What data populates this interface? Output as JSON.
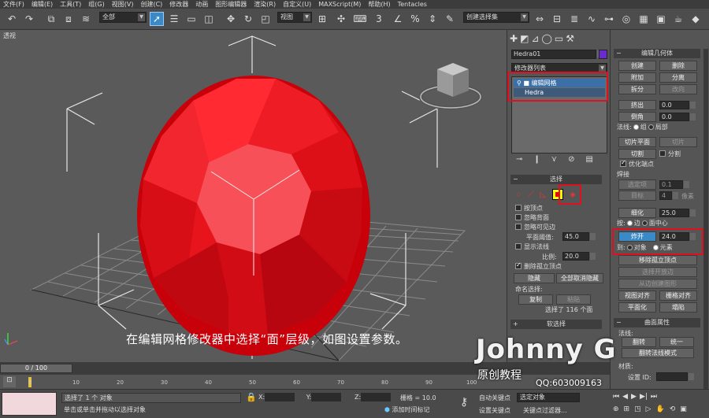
{
  "menubar": [
    "文件(F)",
    "编辑(E)",
    "工具(T)",
    "组(G)",
    "视图(V)",
    "创建(C)",
    "修改器",
    "动画",
    "图形编辑器",
    "渲染(R)",
    "自定义(U)",
    "MAXScript(M)",
    "帮助(H)",
    "Tentacles"
  ],
  "toolbar": {
    "selection_filter": "全部",
    "ref_coord": "视图",
    "named_selection": "创建选择集"
  },
  "viewport": {
    "label": "透视",
    "caption": "在编辑网格修改器中选择“面”层级，如图设置参数。"
  },
  "cmdpanel": {
    "object_name": "Hedra01",
    "modifier_list": "修改器列表",
    "stack": [
      "编辑网格",
      "Hedra"
    ],
    "selection_header": "选择",
    "by_vertex": "按顶点",
    "ignore_backfacing": "忽略背面",
    "ignore_visible_edges": "忽略可见边",
    "planar_thresh_label": "平面阈值:",
    "planar_thresh_value": "45.0",
    "show_normals": "显示法线",
    "scale_label": "比例:",
    "scale_value": "20.0",
    "delete_isolated": "删除孤立顶点",
    "hide": "隐藏",
    "unhide_all": "全部取消隐藏",
    "named_selections": "命名选择:",
    "copy": "复制",
    "paste": "粘贴",
    "selected_count": "选择了 116 个面",
    "soft_selection": "软选择"
  },
  "ribbon": {
    "header": "编辑几何体",
    "create": "创建",
    "delete": "删除",
    "attach": "附加",
    "detach": "分离",
    "split": "拆分",
    "turn": "改向",
    "extrude": "挤出",
    "extrude_value": "0.0",
    "chamfer": "倒角",
    "chamfer_value": "0.0",
    "normal_label": "法线:",
    "group": "组",
    "local": "局部",
    "slice_plane": "切片平面",
    "slice": "切片",
    "cut": "切割",
    "split2": "分割",
    "refine_ends": "优化端点",
    "weld": "焊接",
    "selected": "选定项",
    "selected_value": "0.1",
    "target": "目标",
    "target_value": "4",
    "pixels": "像素",
    "tessellate": "细化",
    "tess_value": "25.0",
    "by_label": "按:",
    "edge": "边",
    "face_center": "面中心",
    "explode": "炸开",
    "explode_value": "24.0",
    "to_label": "到:",
    "to_objects": "对象",
    "to_elements": "元素",
    "remove_isolated": "移除孤立顶点",
    "select_open_edges": "选择开放边",
    "create_shape": "从边创建图形",
    "view_align": "视图对齐",
    "grid_align": "栅格对齐",
    "planarize": "平面化",
    "collapse": "塌陷",
    "surface_header": "曲面属性",
    "normals_label": "法线:",
    "flip": "翻转",
    "unify": "统一",
    "flip_normal_mode": "翻转法线模式",
    "material_label": "材质:",
    "set_id": "设置 ID:"
  },
  "timeline": {
    "frame": "0 / 100",
    "ticks": [
      "0",
      "10",
      "20",
      "30",
      "40",
      "50",
      "60",
      "70",
      "80",
      "90",
      "100"
    ]
  },
  "status": {
    "selected": "选择了 1 个 对象",
    "prompt": "单击或单击并拖动以选择对象",
    "x_label": "X:",
    "y_label": "Y:",
    "z_label": "Z:",
    "grid": "栅格 = 10.0",
    "add_time_tag": "添加时间标记",
    "auto_key": "自动关键点",
    "selected_obj": "选定对象",
    "set_key": "设置关键点",
    "key_filters": "关键点过滤器..."
  },
  "watermark": {
    "name": "Johnny G",
    "sub": "原创教程",
    "qq": "QQ:603009163"
  },
  "colors": {
    "accent": "#3a8ac8",
    "highlight_box": "#e01020",
    "object_color": "#6a2bd0",
    "sphere_red": "#e8141c"
  }
}
